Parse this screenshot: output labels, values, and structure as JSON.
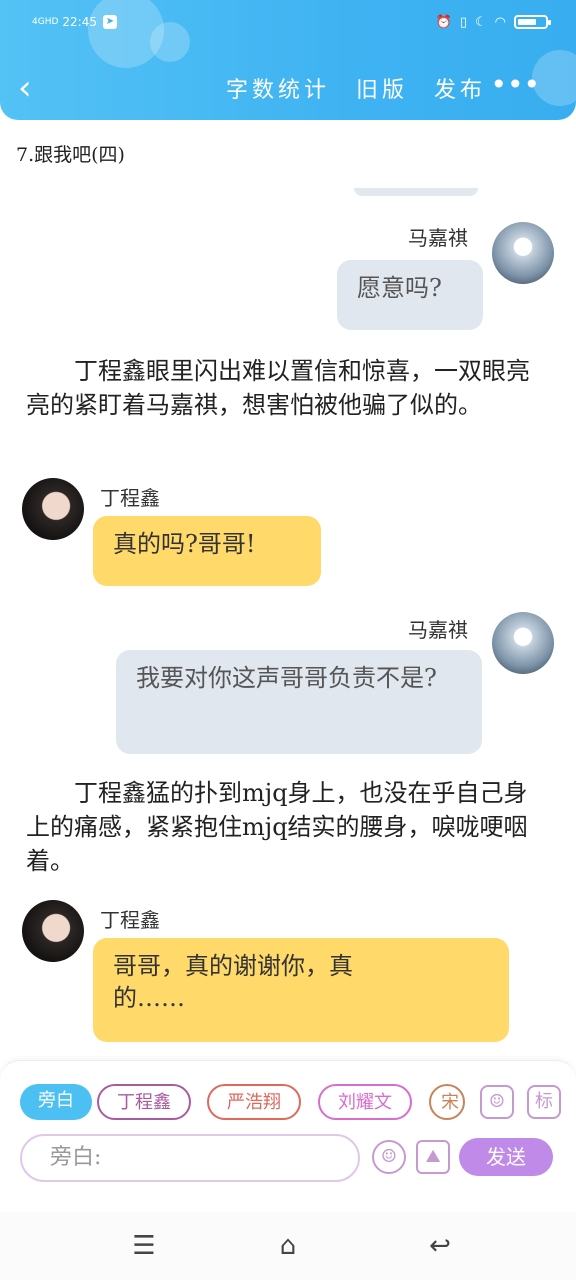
{
  "status_bar": {
    "network": "4GHD",
    "time": "22:45",
    "icons": [
      "alarm-icon",
      "vibrate-icon",
      "moon-icon",
      "wifi-icon",
      "battery-icon"
    ]
  },
  "header": {
    "back_icon": "chevron-left-icon",
    "word_count": "字数统计",
    "old_version": "旧版",
    "publish": "发布",
    "more_icon": "more-dots-icon"
  },
  "chapter_title": "7.跟我吧(四)",
  "messages": [
    {
      "speaker": "马嘉祺",
      "text": "愿意吗?"
    },
    {
      "narration": "丁程鑫眼里闪出难以置信和惊喜，一双眼亮亮的紧盯着马嘉祺，想害怕被他骗了似的。"
    },
    {
      "speaker": "丁程鑫",
      "text": "真的吗?哥哥!"
    },
    {
      "speaker": "马嘉祺",
      "text": "我要对你这声哥哥负责不是?"
    },
    {
      "narration": "丁程鑫猛的扑到mjq身上，也没在乎自己身上的痛感，紧紧抱住mjq结实的腰身，唳咙哽咽着。"
    },
    {
      "speaker": "丁程鑫",
      "text": "哥哥，真的谢谢你，真的……"
    }
  ],
  "composer": {
    "roles": [
      "旁白",
      "丁程鑫",
      "严浩翔",
      "刘耀文",
      "宋"
    ],
    "tag_label": "标",
    "placeholder": "旁白:",
    "send": "发送"
  },
  "colors": {
    "header": "#3fb3f2",
    "grey_bubble": "#e1e7ef",
    "yellow_bubble": "#ffd96a",
    "send": "#c08ae8"
  }
}
